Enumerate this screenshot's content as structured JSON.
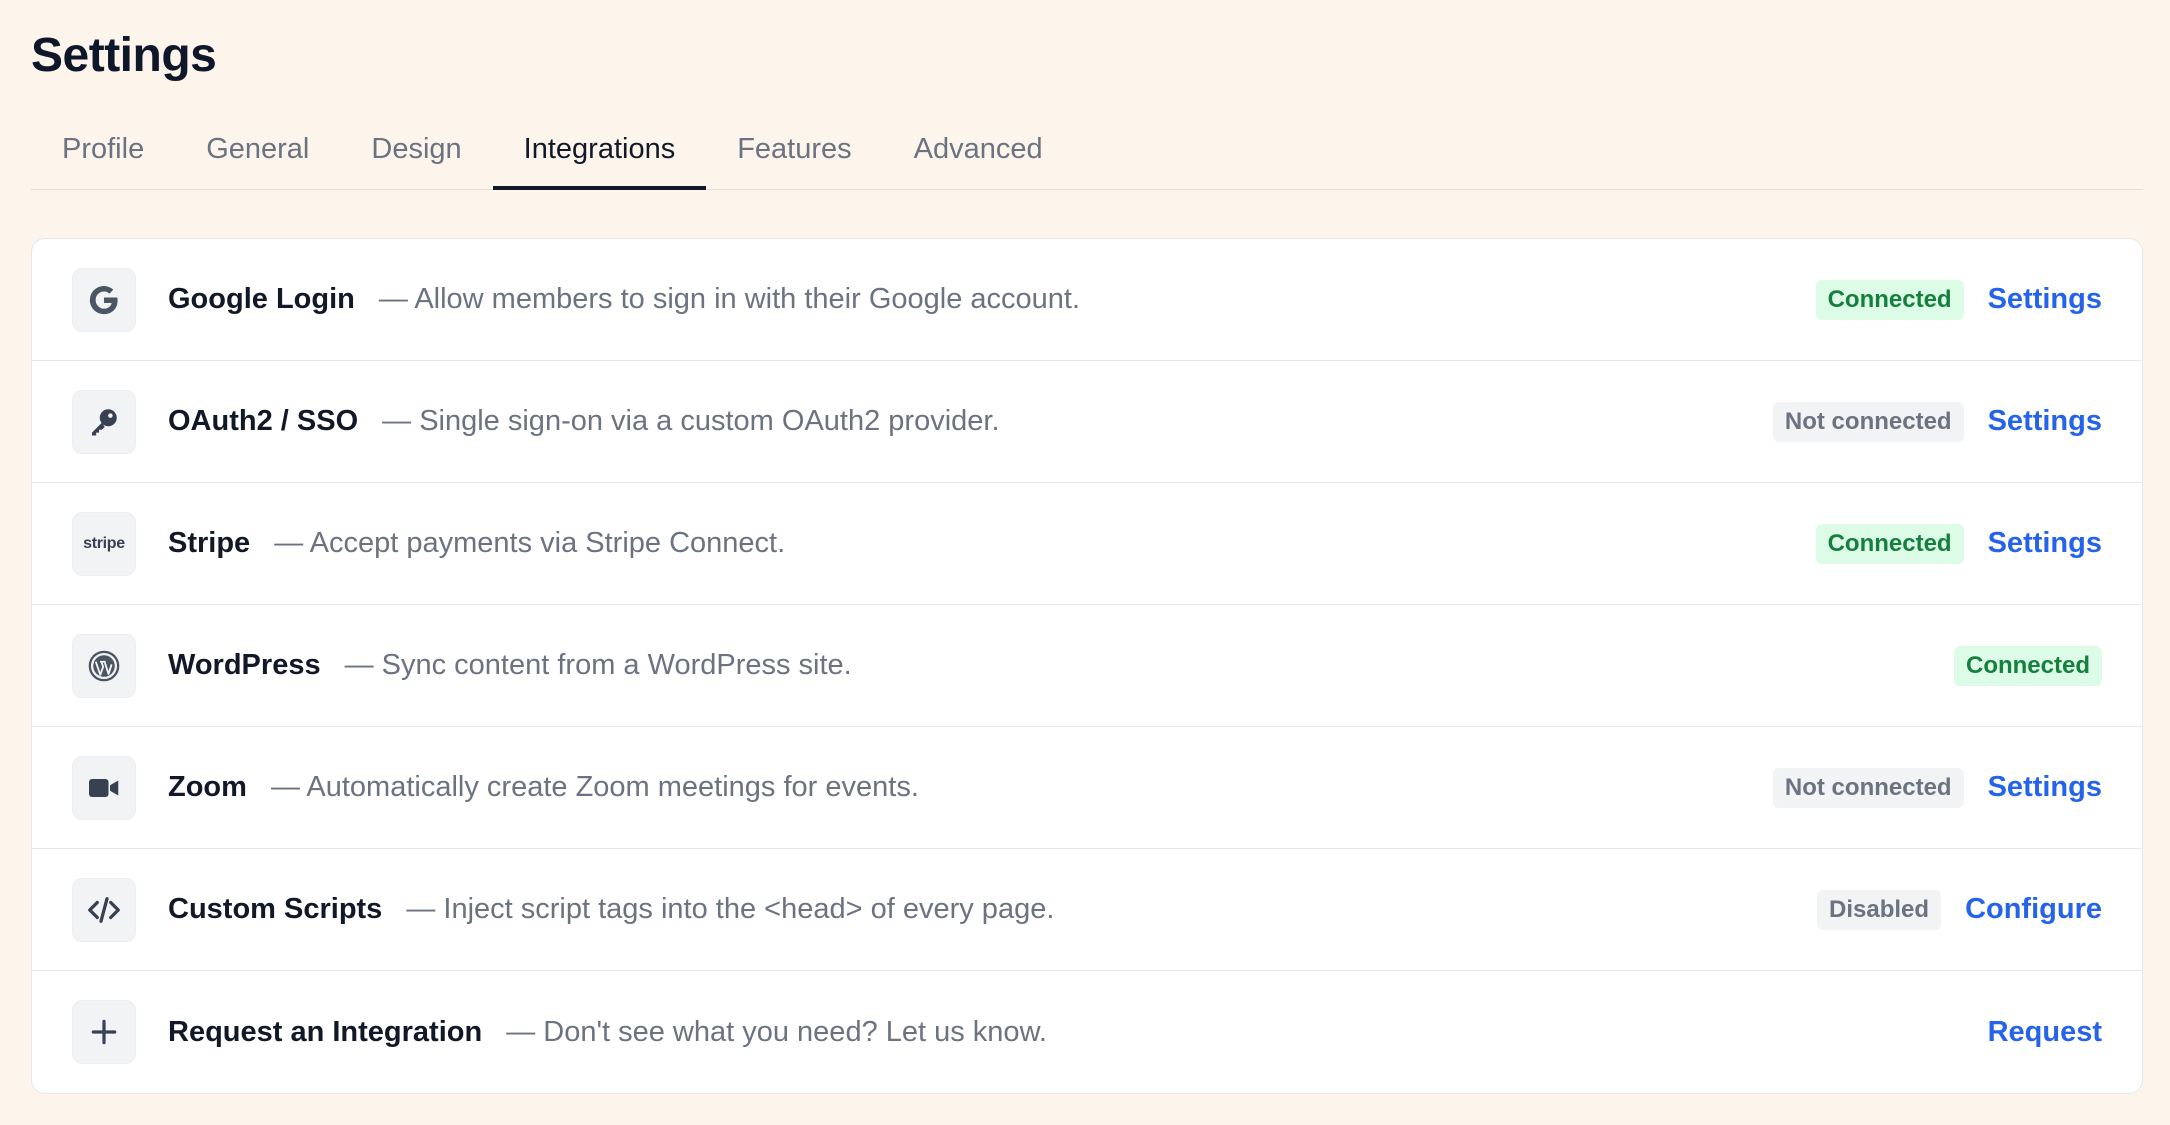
{
  "page": {
    "title": "Settings"
  },
  "tabs": [
    {
      "label": "Profile",
      "active": false
    },
    {
      "label": "General",
      "active": false
    },
    {
      "label": "Design",
      "active": false
    },
    {
      "label": "Integrations",
      "active": true
    },
    {
      "label": "Features",
      "active": false
    },
    {
      "label": "Advanced",
      "active": false
    }
  ],
  "integrations": [
    {
      "icon": "google-g-icon",
      "name": "Google Login",
      "description": "— Allow members to sign in with their Google account.",
      "status": "Connected",
      "action": "Settings"
    },
    {
      "icon": "key-icon",
      "name": "OAuth2 / SSO",
      "description": "— Single sign-on via a custom OAuth2 provider.",
      "status": "Not connected",
      "action": "Settings"
    },
    {
      "icon": "stripe-logo",
      "icon_text": "stripe",
      "name": "Stripe",
      "description": "— Accept payments via Stripe Connect.",
      "status": "Connected",
      "action": "Settings"
    },
    {
      "icon": "wordpress-icon",
      "name": "WordPress",
      "description": "— Sync content from a WordPress site.",
      "status": "Connected"
    },
    {
      "icon": "video-camera-icon",
      "name": "Zoom",
      "description": "— Automatically create Zoom meetings for events.",
      "status": "Not connected",
      "action": "Settings"
    },
    {
      "icon": "code-icon",
      "name": "Custom Scripts",
      "description": "— Inject script tags into the <head> of every page.",
      "status": "Disabled",
      "action": "Configure"
    },
    {
      "icon": "plus-icon",
      "name": "Request an Integration",
      "description": "— Don't see what you need? Let us know.",
      "action": "Request"
    }
  ],
  "colors": {
    "background": "#fdf5ec",
    "link": "#2563eb",
    "connected_bg": "#dcfce7",
    "connected_text": "#15803d",
    "neutral_bg": "#f1f3f5",
    "neutral_text": "#6b7280"
  }
}
